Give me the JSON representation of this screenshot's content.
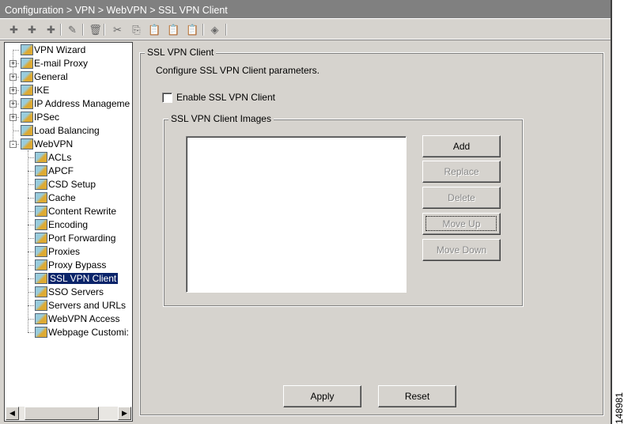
{
  "breadcrumb": "Configuration > VPN > WebVPN > SSL VPN Client",
  "toolbar": [
    "add-icon",
    "insert-icon",
    "insert-after-icon",
    "edit-icon",
    "delete-icon",
    "cut-icon",
    "copy-icon",
    "paste-icon",
    "paste-after-icon",
    "paste-before-icon",
    "find-icon"
  ],
  "tree": [
    {
      "label": "VPN Wizard",
      "level": 0,
      "expander": ""
    },
    {
      "label": "E-mail Proxy",
      "level": 0,
      "expander": "+"
    },
    {
      "label": "General",
      "level": 0,
      "expander": "+"
    },
    {
      "label": "IKE",
      "level": 0,
      "expander": "+"
    },
    {
      "label": "IP Address Manageme",
      "level": 0,
      "expander": "+"
    },
    {
      "label": "IPSec",
      "level": 0,
      "expander": "+"
    },
    {
      "label": "Load Balancing",
      "level": 0,
      "expander": ""
    },
    {
      "label": "WebVPN",
      "level": 0,
      "expander": "-"
    },
    {
      "label": "ACLs",
      "level": 1
    },
    {
      "label": "APCF",
      "level": 1
    },
    {
      "label": "CSD Setup",
      "level": 1
    },
    {
      "label": "Cache",
      "level": 1
    },
    {
      "label": "Content Rewrite",
      "level": 1
    },
    {
      "label": "Encoding",
      "level": 1
    },
    {
      "label": "Port Forwarding",
      "level": 1
    },
    {
      "label": "Proxies",
      "level": 1
    },
    {
      "label": "Proxy Bypass",
      "level": 1
    },
    {
      "label": "SSL VPN Client",
      "level": 1,
      "selected": true
    },
    {
      "label": "SSO Servers",
      "level": 1
    },
    {
      "label": "Servers and URLs",
      "level": 1
    },
    {
      "label": "WebVPN Access",
      "level": 1
    },
    {
      "label": "Webpage Customi:",
      "level": 1
    }
  ],
  "panel": {
    "title": "SSL VPN Client",
    "description": "Configure SSL VPN Client parameters.",
    "enable_label": "Enable SSL VPN Client",
    "enable_checked": false,
    "images_group": "SSL VPN Client Images",
    "buttons": {
      "add": "Add",
      "replace": "Replace",
      "delete": "Delete",
      "move_up": "Move Up",
      "move_down": "Move Down"
    },
    "apply": "Apply",
    "reset": "Reset"
  },
  "figure_id": "148981"
}
